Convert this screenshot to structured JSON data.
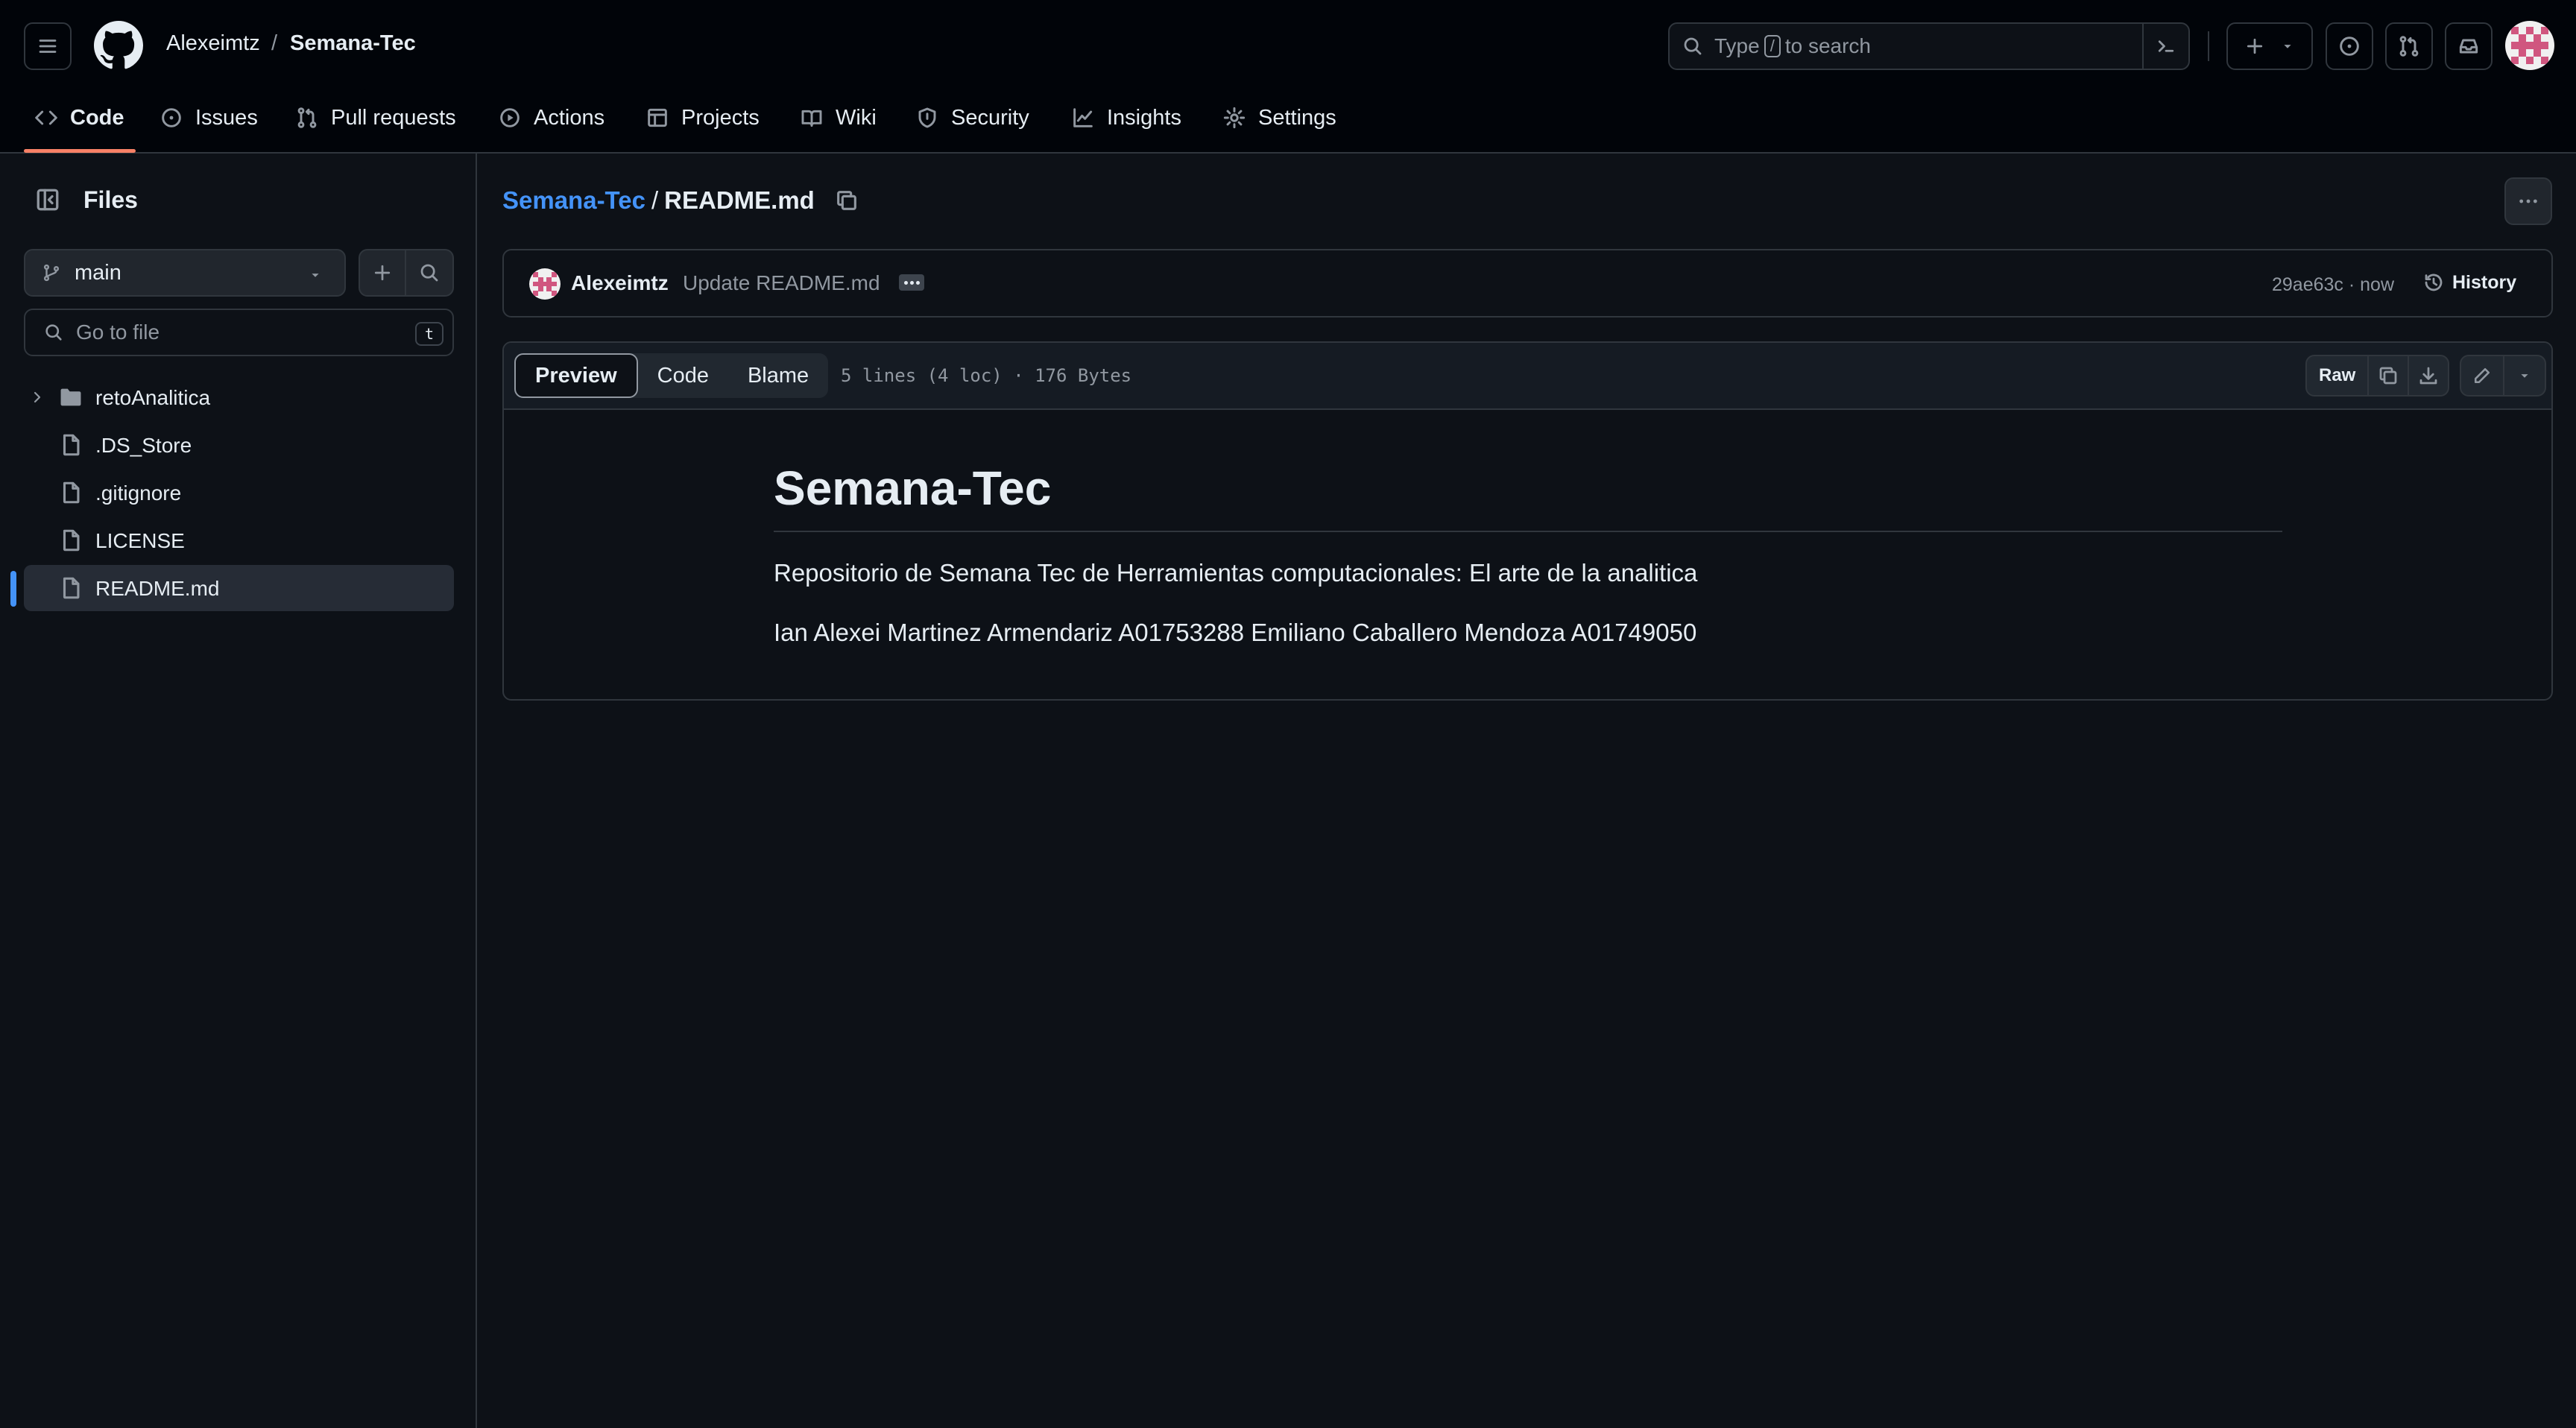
{
  "header": {
    "owner": "Alexeimtz",
    "separator": "/",
    "repo": "Semana-Tec",
    "search": {
      "before": "Type",
      "key": "/",
      "after": "to search"
    }
  },
  "repo_nav": [
    {
      "label": "Code",
      "icon": "code-icon",
      "active": true
    },
    {
      "label": "Issues",
      "icon": "issue-opened-icon"
    },
    {
      "label": "Pull requests",
      "icon": "git-pull-request-icon"
    },
    {
      "label": "Actions",
      "icon": "play-icon"
    },
    {
      "label": "Projects",
      "icon": "table-icon"
    },
    {
      "label": "Wiki",
      "icon": "book-icon"
    },
    {
      "label": "Security",
      "icon": "shield-icon"
    },
    {
      "label": "Insights",
      "icon": "graph-icon"
    },
    {
      "label": "Settings",
      "icon": "gear-icon"
    }
  ],
  "sidebar": {
    "title": "Files",
    "branch": "main",
    "goto_placeholder": "Go to file",
    "goto_key": "t",
    "tree": [
      {
        "label": "retoAnalitica",
        "type": "folder"
      },
      {
        "label": ".DS_Store",
        "type": "file"
      },
      {
        "label": ".gitignore",
        "type": "file"
      },
      {
        "label": "LICENSE",
        "type": "file"
      },
      {
        "label": "README.md",
        "type": "file",
        "selected": true
      }
    ]
  },
  "main": {
    "path_repo": "Semana-Tec",
    "path_sep": "/",
    "path_file": "README.md",
    "commit": {
      "author": "Alexeimtz",
      "message": "Update README.md",
      "hash_time": "29ae63c · now",
      "history_label": "History"
    },
    "file": {
      "tabs": [
        "Preview",
        "Code",
        "Blame"
      ],
      "active_tab": "Preview",
      "meta": "5 lines (4 loc) · 176 Bytes",
      "raw_label": "Raw"
    },
    "readme": {
      "title": "Semana-Tec",
      "line1": "Repositorio de Semana Tec de Herramientas computacionales: El arte de la analitica",
      "line2": "Ian Alexei Martinez Armendariz A01753288 Emiliano Caballero Mendoza A01749050"
    }
  },
  "colors": {
    "background": "#0d1117",
    "header_bg": "#010409",
    "accent_link": "#4493f8",
    "nav_underline": "#f78166",
    "border": "#30363d"
  }
}
